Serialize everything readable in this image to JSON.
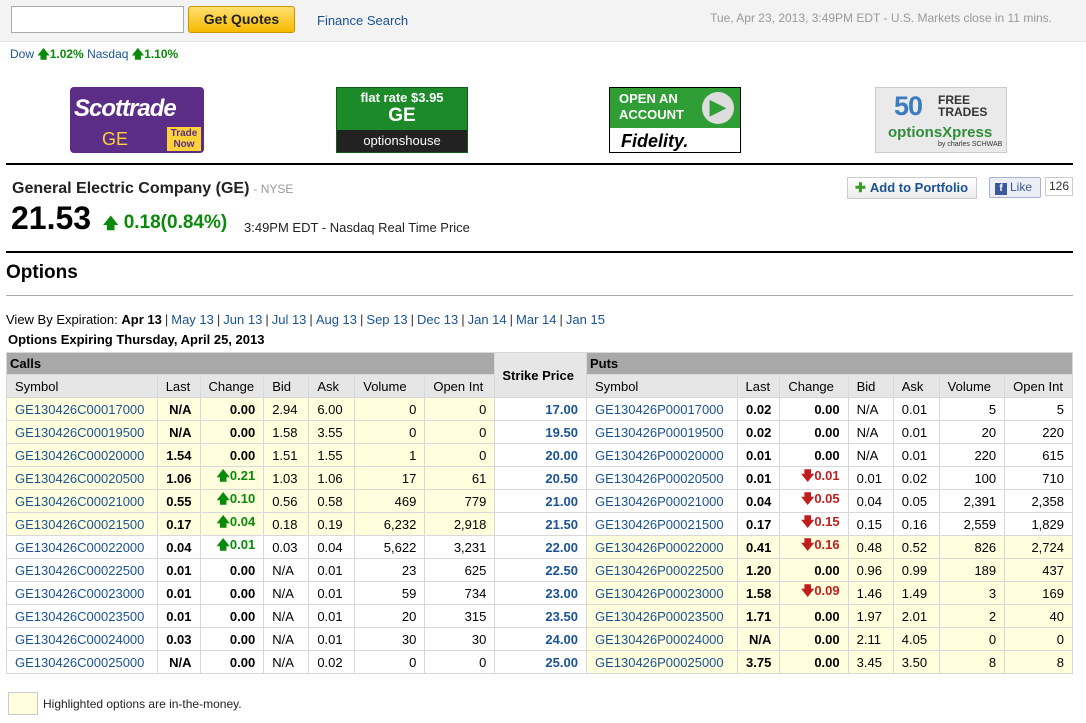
{
  "topbar": {
    "quote_input_value": "",
    "get_quotes_label": "Get Quotes",
    "finance_search_label": "Finance Search",
    "market_status": "Tue, Apr 23, 2013, 3:49PM EDT - U.S. Markets close in 11 mins."
  },
  "indices": {
    "dow_label": "Dow",
    "dow_change": "1.02%",
    "nasdaq_label": "Nasdaq",
    "nasdaq_change": "1.10%"
  },
  "ads": {
    "scottrade": {
      "brand": "Scottrade",
      "ticker": "GE",
      "cta": "Trade Now"
    },
    "optionshouse": {
      "line1": "flat rate $3.95",
      "ticker": "GE",
      "brand": "optionshouse"
    },
    "fidelity": {
      "line1": "OPEN AN ACCOUNT",
      "brand": "Fidelity."
    },
    "optionsxpress": {
      "num": "50",
      "line1": "FREE TRADES",
      "brand": "optionsXpress",
      "sub": "by charles SCHWAB"
    }
  },
  "quote": {
    "company": "General Electric Company (GE)",
    "exchange": "- NYSE",
    "price": "21.53",
    "change": "0.18(0.84%)",
    "time": "3:49PM EDT - Nasdaq Real Time Price",
    "add_portfolio": "Add to Portfolio",
    "like_label": "Like",
    "like_count": "126"
  },
  "options": {
    "title": "Options",
    "view_by_label": "View By Expiration:",
    "current_expiration": "Apr 13",
    "expirations": [
      "May 13",
      "Jun 13",
      "Jul 13",
      "Aug 13",
      "Sep 13",
      "Dec 13",
      "Jan 14",
      "Mar 14",
      "Jan 15"
    ],
    "expiring_label": "Options Expiring Thursday, April 25, 2013",
    "calls_label": "Calls",
    "puts_label": "Puts",
    "strike_label": "Strike Price",
    "columns": [
      "Symbol",
      "Last",
      "Change",
      "Bid",
      "Ask",
      "Volume",
      "Open Int"
    ],
    "legend": "Highlighted options are in-the-money.",
    "rows": [
      {
        "strike": "17.00",
        "c": {
          "sym": "GE130426C00017000",
          "last": "N/A",
          "chg": "0.00",
          "dir": "",
          "bid": "2.94",
          "ask": "6.00",
          "vol": "0",
          "oi": "0"
        },
        "p": {
          "sym": "GE130426P00017000",
          "last": "0.02",
          "chg": "0.00",
          "dir": "",
          "bid": "N/A",
          "ask": "0.01",
          "vol": "5",
          "oi": "5"
        },
        "itm": "call"
      },
      {
        "strike": "19.50",
        "c": {
          "sym": "GE130426C00019500",
          "last": "N/A",
          "chg": "0.00",
          "dir": "",
          "bid": "1.58",
          "ask": "3.55",
          "vol": "0",
          "oi": "0"
        },
        "p": {
          "sym": "GE130426P00019500",
          "last": "0.02",
          "chg": "0.00",
          "dir": "",
          "bid": "N/A",
          "ask": "0.01",
          "vol": "20",
          "oi": "220"
        },
        "itm": "call"
      },
      {
        "strike": "20.00",
        "c": {
          "sym": "GE130426C00020000",
          "last": "1.54",
          "chg": "0.00",
          "dir": "",
          "bid": "1.51",
          "ask": "1.55",
          "vol": "1",
          "oi": "0"
        },
        "p": {
          "sym": "GE130426P00020000",
          "last": "0.01",
          "chg": "0.00",
          "dir": "",
          "bid": "N/A",
          "ask": "0.01",
          "vol": "220",
          "oi": "615"
        },
        "itm": "call"
      },
      {
        "strike": "20.50",
        "c": {
          "sym": "GE130426C00020500",
          "last": "1.06",
          "chg": "0.21",
          "dir": "up",
          "bid": "1.03",
          "ask": "1.06",
          "vol": "17",
          "oi": "61"
        },
        "p": {
          "sym": "GE130426P00020500",
          "last": "0.01",
          "chg": "0.01",
          "dir": "down",
          "bid": "0.01",
          "ask": "0.02",
          "vol": "100",
          "oi": "710"
        },
        "itm": "call"
      },
      {
        "strike": "21.00",
        "c": {
          "sym": "GE130426C00021000",
          "last": "0.55",
          "chg": "0.10",
          "dir": "up",
          "bid": "0.56",
          "ask": "0.58",
          "vol": "469",
          "oi": "779"
        },
        "p": {
          "sym": "GE130426P00021000",
          "last": "0.04",
          "chg": "0.05",
          "dir": "down",
          "bid": "0.04",
          "ask": "0.05",
          "vol": "2,391",
          "oi": "2,358"
        },
        "itm": "call"
      },
      {
        "strike": "21.50",
        "c": {
          "sym": "GE130426C00021500",
          "last": "0.17",
          "chg": "0.04",
          "dir": "up",
          "bid": "0.18",
          "ask": "0.19",
          "vol": "6,232",
          "oi": "2,918"
        },
        "p": {
          "sym": "GE130426P00021500",
          "last": "0.17",
          "chg": "0.15",
          "dir": "down",
          "bid": "0.15",
          "ask": "0.16",
          "vol": "2,559",
          "oi": "1,829"
        },
        "itm": "call"
      },
      {
        "strike": "22.00",
        "c": {
          "sym": "GE130426C00022000",
          "last": "0.04",
          "chg": "0.01",
          "dir": "up",
          "bid": "0.03",
          "ask": "0.04",
          "vol": "5,622",
          "oi": "3,231"
        },
        "p": {
          "sym": "GE130426P00022000",
          "last": "0.41",
          "chg": "0.16",
          "dir": "down",
          "bid": "0.48",
          "ask": "0.52",
          "vol": "826",
          "oi": "2,724"
        },
        "itm": "put"
      },
      {
        "strike": "22.50",
        "c": {
          "sym": "GE130426C00022500",
          "last": "0.01",
          "chg": "0.00",
          "dir": "",
          "bid": "N/A",
          "ask": "0.01",
          "vol": "23",
          "oi": "625"
        },
        "p": {
          "sym": "GE130426P00022500",
          "last": "1.20",
          "chg": "0.00",
          "dir": "",
          "bid": "0.96",
          "ask": "0.99",
          "vol": "189",
          "oi": "437"
        },
        "itm": "put"
      },
      {
        "strike": "23.00",
        "c": {
          "sym": "GE130426C00023000",
          "last": "0.01",
          "chg": "0.00",
          "dir": "",
          "bid": "N/A",
          "ask": "0.01",
          "vol": "59",
          "oi": "734"
        },
        "p": {
          "sym": "GE130426P00023000",
          "last": "1.58",
          "chg": "0.09",
          "dir": "down",
          "bid": "1.46",
          "ask": "1.49",
          "vol": "3",
          "oi": "169"
        },
        "itm": "put"
      },
      {
        "strike": "23.50",
        "c": {
          "sym": "GE130426C00023500",
          "last": "0.01",
          "chg": "0.00",
          "dir": "",
          "bid": "N/A",
          "ask": "0.01",
          "vol": "20",
          "oi": "315"
        },
        "p": {
          "sym": "GE130426P00023500",
          "last": "1.71",
          "chg": "0.00",
          "dir": "",
          "bid": "1.97",
          "ask": "2.01",
          "vol": "2",
          "oi": "40"
        },
        "itm": "put"
      },
      {
        "strike": "24.00",
        "c": {
          "sym": "GE130426C00024000",
          "last": "0.03",
          "chg": "0.00",
          "dir": "",
          "bid": "N/A",
          "ask": "0.01",
          "vol": "30",
          "oi": "30"
        },
        "p": {
          "sym": "GE130426P00024000",
          "last": "N/A",
          "chg": "0.00",
          "dir": "",
          "bid": "2.11",
          "ask": "4.05",
          "vol": "0",
          "oi": "0"
        },
        "itm": "put"
      },
      {
        "strike": "25.00",
        "c": {
          "sym": "GE130426C00025000",
          "last": "N/A",
          "chg": "0.00",
          "dir": "",
          "bid": "N/A",
          "ask": "0.02",
          "vol": "0",
          "oi": "0"
        },
        "p": {
          "sym": "GE130426P00025000",
          "last": "3.75",
          "chg": "0.00",
          "dir": "",
          "bid": "3.45",
          "ask": "3.50",
          "vol": "8",
          "oi": "8"
        },
        "itm": "put"
      }
    ]
  },
  "colors": {
    "link": "#1a5294",
    "up": "#0a8a0a",
    "down": "#c21d1d",
    "itm_highlight": "#ffffdd",
    "header_gray": "#a8a8a8"
  }
}
